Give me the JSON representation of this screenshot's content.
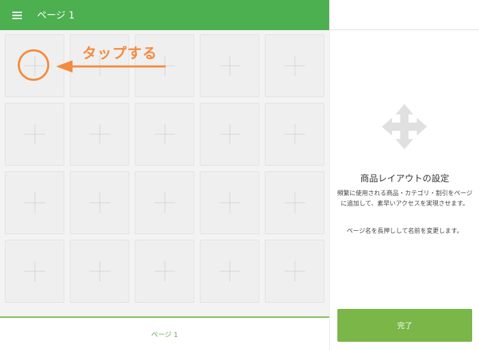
{
  "header": {
    "title": "ページ 1",
    "menu_icon": "hamburger-menu-icon"
  },
  "grid": {
    "rows": 4,
    "columns": 5,
    "tile_icon": "plus-icon"
  },
  "tutorial": {
    "label": "タップする",
    "color": "#f58a3d"
  },
  "page_tabs": [
    {
      "label": "ページ 1"
    }
  ],
  "side_panel": {
    "icon": "move-arrows-icon",
    "title": "商品レイアウトの設定",
    "description": "頻繁に使用される商品・カテゴリ・割引をページに追加して、素早いアクセスを実現させます。",
    "note": "ページ名を長押しして名前を変更します。",
    "done_label": "完了"
  },
  "colors": {
    "header": "#4caf50",
    "button": "#7ab648",
    "tab_text": "#6aa84f"
  }
}
